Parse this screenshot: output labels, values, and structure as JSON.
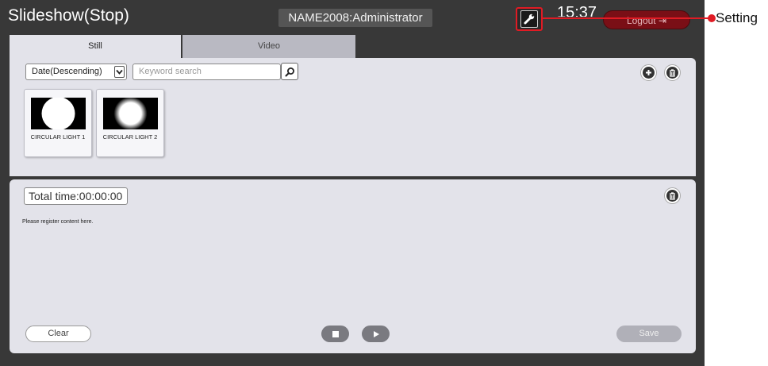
{
  "header": {
    "title": "Slideshow(Stop)",
    "user": "NAME2008:Administrator",
    "time": "15:37",
    "logout_label": "Logout",
    "settings_icon": "wrench-icon"
  },
  "tabs": [
    {
      "label": "Still",
      "active": true
    },
    {
      "label": "Video",
      "active": false
    }
  ],
  "library": {
    "sort_value": "Date(Descending)",
    "search_placeholder": "Keyword search",
    "items": [
      {
        "label": "CIRCULAR LIGHT 1"
      },
      {
        "label": "CIRCULAR LIGHT 2"
      }
    ]
  },
  "playlist": {
    "total_time": "Total time:00:00:00",
    "hint": "Please register content here.",
    "clear_label": "Clear",
    "save_label": "Save"
  },
  "callout": {
    "label": "Setting"
  },
  "colors": {
    "app_background": "#383838",
    "panel": "#e3e3ea",
    "accent_red": "#e01b24",
    "logout": "#7a0f16"
  }
}
